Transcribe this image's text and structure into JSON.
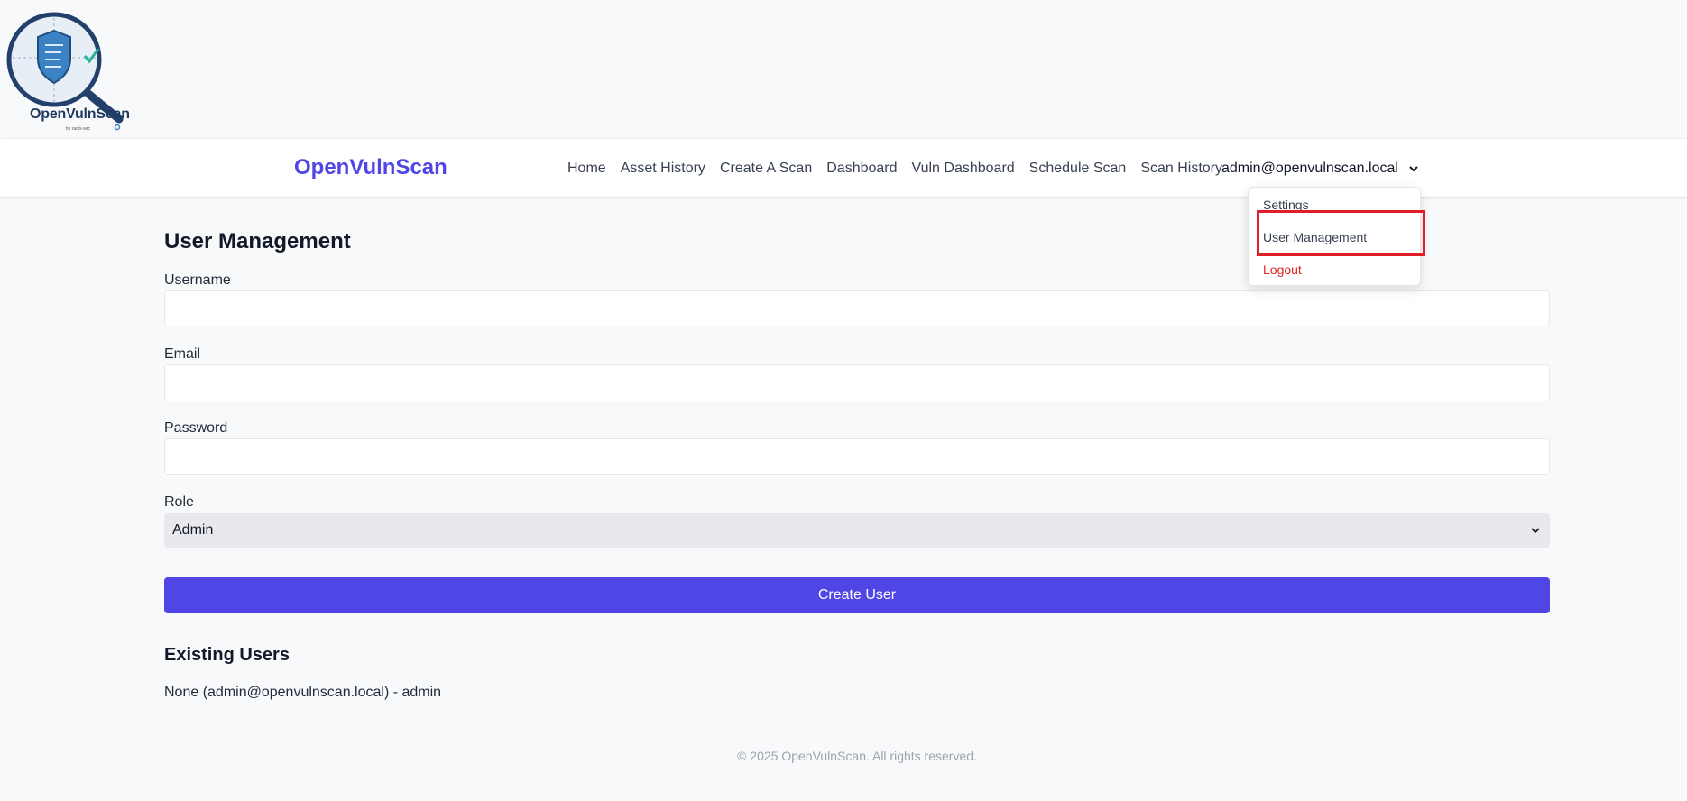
{
  "logo": {
    "name": "OpenVulnScan",
    "byline": "by radix-sec"
  },
  "navbar": {
    "brand": "OpenVulnScan",
    "links": [
      {
        "label": "Home"
      },
      {
        "label": "Asset History"
      },
      {
        "label": "Create A Scan"
      },
      {
        "label": "Dashboard"
      },
      {
        "label": "Vuln Dashboard"
      },
      {
        "label": "Schedule Scan"
      },
      {
        "label": "Scan History"
      }
    ],
    "user_email": "admin@openvulnscan.local",
    "dropdown": {
      "settings": "Settings",
      "user_management": "User Management",
      "logout": "Logout"
    }
  },
  "form": {
    "title": "User Management",
    "username_label": "Username",
    "username_value": "",
    "email_label": "Email",
    "email_value": "",
    "password_label": "Password",
    "password_value": "",
    "role_label": "Role",
    "role_selected": "Admin",
    "submit_label": "Create User"
  },
  "existing_users": {
    "title": "Existing Users",
    "items": [
      {
        "text": "None (admin@openvulnscan.local) - admin"
      }
    ]
  },
  "footer": {
    "text": "© 2025 OpenVulnScan. All rights reserved."
  },
  "colors": {
    "brand": "#4f46e5",
    "logout": "#dc2626",
    "highlight": "#e11d2a",
    "background": "#f8f9fb"
  },
  "icons": {
    "logo": "magnifier-shield-icon",
    "user_menu": "chevron-down-icon",
    "select": "chevron-down-icon"
  }
}
